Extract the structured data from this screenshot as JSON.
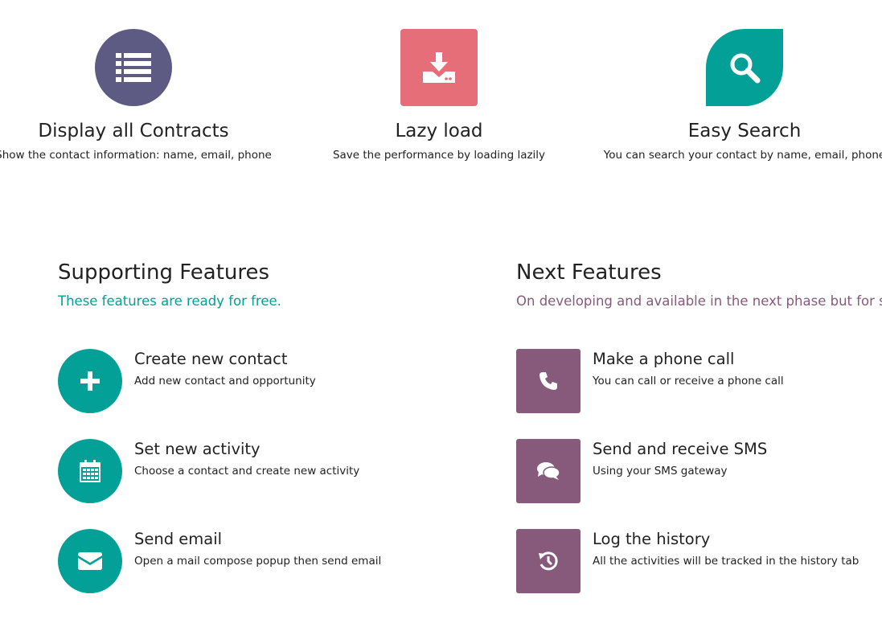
{
  "colors": {
    "dark_purple": "#5d5b84",
    "salmon": "#e56e79",
    "teal": "#02a096",
    "mauve": "#875a7b"
  },
  "top_features": [
    {
      "title": "Display all Contracts",
      "description": "Show the contact information: name, email, phone",
      "icon": "list-icon"
    },
    {
      "title": "Lazy load",
      "description": "Save the performance by loading lazily",
      "icon": "download-icon"
    },
    {
      "title": "Easy Search",
      "description": "You can search your contact by name, email, phone",
      "icon": "search-icon"
    }
  ],
  "supporting": {
    "title": "Supporting Features",
    "subtitle": "These features are ready for free.",
    "items": [
      {
        "title": "Create new contact",
        "description": "Add new contact and opportunity",
        "icon": "plus-icon"
      },
      {
        "title": "Set new activity",
        "description": "Choose a contact and create new activity",
        "icon": "calendar-icon"
      },
      {
        "title": "Send email",
        "description": "Open a mail compose popup then send email",
        "icon": "envelope-icon"
      }
    ]
  },
  "next": {
    "title": "Next Features",
    "subtitle": "On developing and available in the next phase but for sale",
    "items": [
      {
        "title": "Make a phone call",
        "description": "You can call or receive a phone call",
        "icon": "phone-icon"
      },
      {
        "title": "Send and receive SMS",
        "description": "Using your SMS gateway",
        "icon": "chat-icon"
      },
      {
        "title": "Log the history",
        "description": "All the activities will be tracked in the history tab",
        "icon": "history-icon"
      }
    ]
  }
}
